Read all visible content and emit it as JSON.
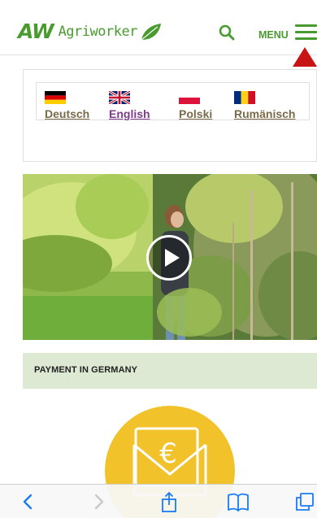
{
  "header": {
    "logo_letters": "AW",
    "logo_text": "Agriworker",
    "menu_label": "MENU"
  },
  "languages": [
    {
      "label": "Deutsch",
      "flag": [
        "#000000",
        "#dd0000",
        "#ffce00"
      ],
      "active": false
    },
    {
      "label": "English",
      "flag": "uk",
      "active": true
    },
    {
      "label": "Polski",
      "flag": [
        "#ffffff",
        "#dc143c"
      ],
      "active": false
    },
    {
      "label": "Rumänisch",
      "flag": [
        "#002b7f",
        "#fcd116",
        "#ce1126"
      ],
      "active": false
    }
  ],
  "section": {
    "payment_title": "PAYMENT IN GERMANY"
  },
  "icons": {
    "coin": "euro-envelope-icon",
    "currency_symbol": "€"
  },
  "colors": {
    "brand_green": "#4a9b2f",
    "payment_bar": "#dde9d3",
    "coin_yellow": "#f2c22a",
    "active_link": "#7d3c8c",
    "link": "#7a6a4a"
  }
}
